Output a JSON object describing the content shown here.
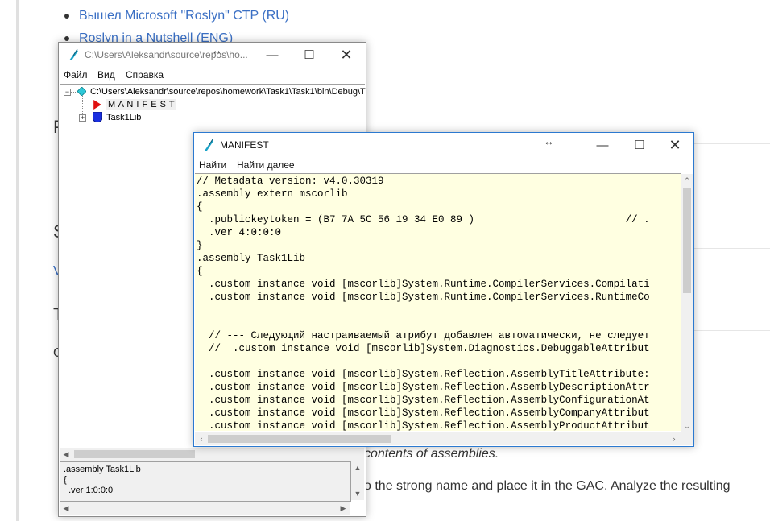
{
  "page": {
    "links": [
      "Вышел Microsoft \"Roslyn\" CTP (RU)",
      "Roslyn in a Nutshell (ENG)"
    ],
    "heading_fragments": [
      "P",
      "S",
      "T"
    ],
    "link_fragment": "V",
    "text_fragment": "C",
    "italic_text": "contents of assemblies.",
    "body_text": "o the strong name and place it in the GAC. Analyze the resulting"
  },
  "ildasm_main": {
    "title": "C:\\Users\\Aleksandr\\source\\repos\\ho...",
    "menu": [
      "Файл",
      "Вид",
      "Справка"
    ],
    "tree_root": "C:\\Users\\Aleksandr\\source\\repos\\homework\\Task1\\Task1\\bin\\Debug\\T",
    "tree_items": [
      "M A N I F E S T",
      "Task1Lib"
    ],
    "info_lines": [
      ".assembly Task1Lib",
      "{",
      "  .ver 1:0:0:0"
    ]
  },
  "manifest_window": {
    "title": "MANIFEST",
    "menu": [
      "Найти",
      "Найти далее"
    ],
    "code_lines": [
      "// Metadata version: v4.0.30319",
      ".assembly extern mscorlib",
      "{",
      "  .publickeytoken = (B7 7A 5C 56 19 34 E0 89 )                         // .",
      "  .ver 4:0:0:0",
      "}",
      ".assembly Task1Lib",
      "{",
      "  .custom instance void [mscorlib]System.Runtime.CompilerServices.Compilati",
      "  .custom instance void [mscorlib]System.Runtime.CompilerServices.RuntimeCo",
      "",
      "",
      "  // --- Следующий настраиваемый атрибут добавлен автоматически, не следует",
      "  //  .custom instance void [mscorlib]System.Diagnostics.DebuggableAttribut",
      "",
      "  .custom instance void [mscorlib]System.Reflection.AssemblyTitleAttribute:",
      "  .custom instance void [mscorlib]System.Reflection.AssemblyDescriptionAttr",
      "  .custom instance void [mscorlib]System.Reflection.AssemblyConfigurationAt",
      "  .custom instance void [mscorlib]System.Reflection.AssemblyCompanyAttribut",
      "  .custom instance void [mscorlib]System.Reflection.AssemblyProductAttribut"
    ]
  },
  "colors": {
    "link": "#3a6fc4",
    "code_bg": "#ffffe1",
    "active_border": "#2b79d0"
  },
  "icons": [
    "ildasm-icon",
    "minimize-icon",
    "maximize-icon",
    "close-icon",
    "resize-cursor-icon",
    "manifest-arrow-icon",
    "namespace-shield-icon",
    "assembly-diamond-icon"
  ]
}
